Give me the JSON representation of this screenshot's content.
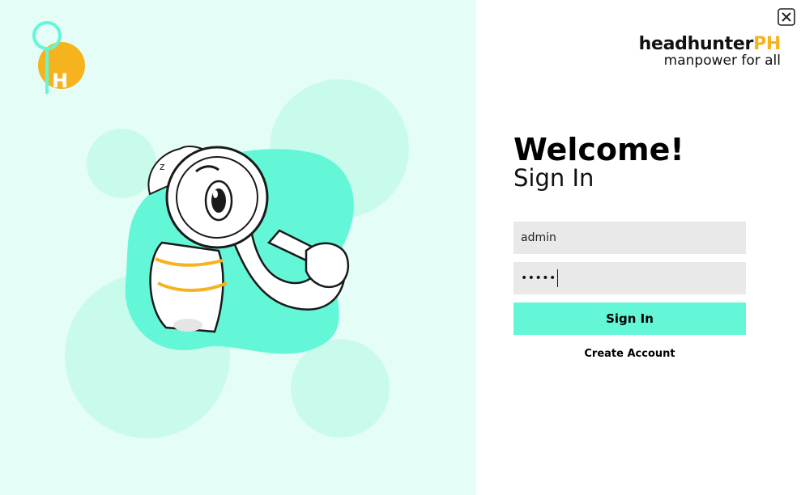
{
  "brand": {
    "name_main": "headhunter",
    "name_accent": "PH",
    "tagline": "manpower for all",
    "accent_color": "#f5b31e",
    "mint_color": "#63f7d8"
  },
  "form": {
    "welcome": "Welcome!",
    "heading": "Sign In",
    "username_value": "admin",
    "password_masked": "•••••",
    "signin_label": "Sign In",
    "create_account_label": "Create Account"
  },
  "icons": {
    "close": "close-icon",
    "logo": "headhunter-logo-icon",
    "illustration": "magnifier-character-illustration"
  },
  "logo_letter": "H"
}
